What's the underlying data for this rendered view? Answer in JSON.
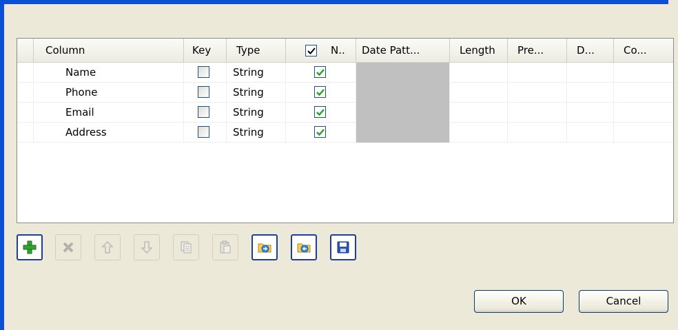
{
  "grid": {
    "headers": {
      "column": "Column",
      "key": "Key",
      "type": "Type",
      "nullable": "N..",
      "date_pattern": "Date Patt...",
      "length": "Length",
      "precision": "Pre...",
      "default": "D...",
      "comment": "Co..."
    },
    "header_nullable_checked": true,
    "rows": [
      {
        "column": "Name",
        "key": false,
        "type": "String",
        "nullable": true
      },
      {
        "column": "Phone",
        "key": false,
        "type": "String",
        "nullable": true
      },
      {
        "column": "Email",
        "key": false,
        "type": "String",
        "nullable": true
      },
      {
        "column": "Address",
        "key": false,
        "type": "String",
        "nullable": true
      }
    ]
  },
  "toolbar": {
    "buttons": [
      {
        "icon": "add-icon",
        "enabled": true
      },
      {
        "icon": "delete-icon",
        "enabled": false
      },
      {
        "icon": "move-up-icon",
        "enabled": false
      },
      {
        "icon": "move-down-icon",
        "enabled": false
      },
      {
        "icon": "copy-icon",
        "enabled": false
      },
      {
        "icon": "paste-icon",
        "enabled": false
      },
      {
        "icon": "import-schema-icon",
        "enabled": true
      },
      {
        "icon": "export-schema-icon",
        "enabled": true
      },
      {
        "icon": "save-icon",
        "enabled": true
      }
    ]
  },
  "dialog": {
    "ok_label": "OK",
    "cancel_label": "Cancel"
  },
  "colors": {
    "window_bg": "#ece9d8",
    "frame_blue": "#0a4fd6",
    "check_green": "#21a121",
    "disabled_cell": "#c0c0c0"
  }
}
